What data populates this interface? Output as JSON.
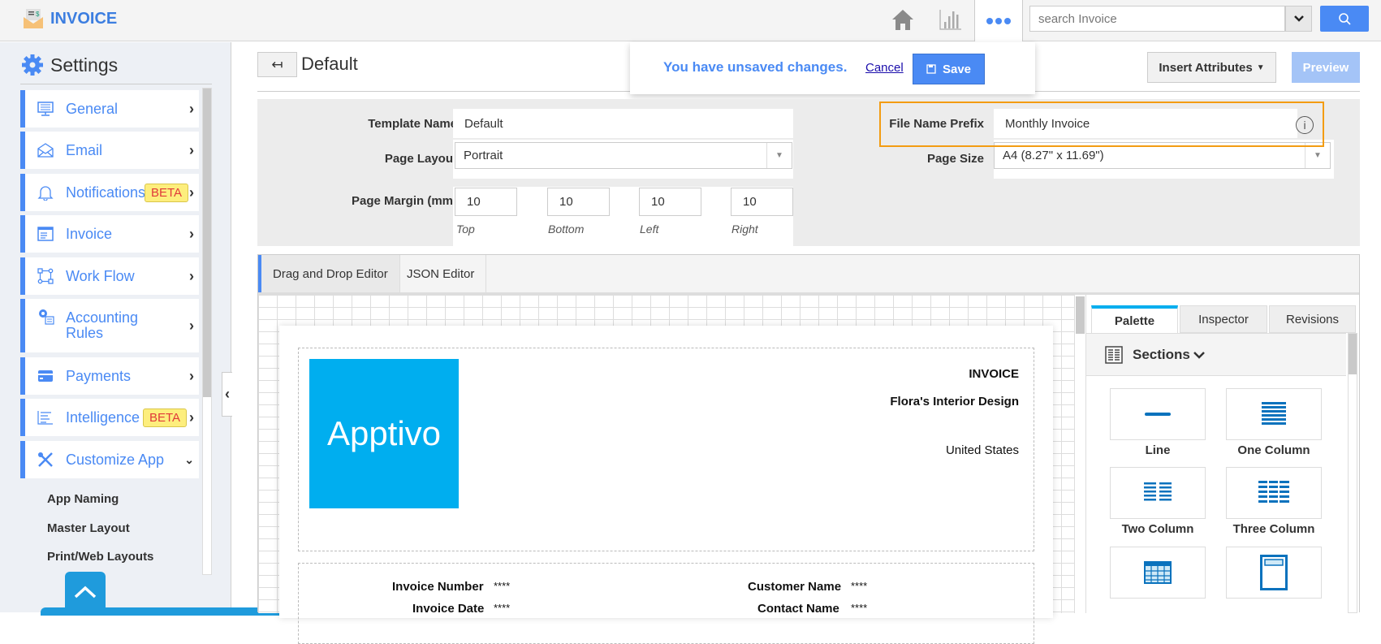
{
  "app": {
    "name": "INVOICE"
  },
  "topbar": {
    "search_placeholder": "search Invoice",
    "icons": [
      "home-icon",
      "chart-icon",
      "more-icon",
      "search-icon"
    ]
  },
  "sidebar": {
    "title": "Settings",
    "items": [
      {
        "label": "General",
        "icon": "monitor-icon"
      },
      {
        "label": "Email",
        "icon": "envelope-icon"
      },
      {
        "label": "Notifications",
        "icon": "bell-icon",
        "badge": "BETA"
      },
      {
        "label": "Invoice",
        "icon": "invoice-icon"
      },
      {
        "label": "Work Flow",
        "icon": "workflow-icon"
      },
      {
        "label": "Accounting Rules",
        "icon": "accounting-icon"
      },
      {
        "label": "Payments",
        "icon": "card-icon"
      },
      {
        "label": "Intelligence",
        "icon": "report-icon",
        "badge": "BETA"
      },
      {
        "label": "Customize App",
        "icon": "tools-icon",
        "expanded": true
      }
    ],
    "sub_items": [
      "App Naming",
      "Master Layout",
      "Print/Web Layouts"
    ]
  },
  "header": {
    "title": "Default",
    "unsaved_message": "You have unsaved changes.",
    "cancel_label": "Cancel",
    "save_label": "Save",
    "insert_attributes_label": "Insert Attributes",
    "preview_label": "Preview"
  },
  "form": {
    "template_name_label": "Template Name",
    "template_name_value": "Default",
    "page_layout_label": "Page Layout",
    "page_layout_value": "Portrait",
    "page_margin_label": "Page Margin (mm)",
    "margins": [
      {
        "label": "Top",
        "value": "10"
      },
      {
        "label": "Bottom",
        "value": "10"
      },
      {
        "label": "Left",
        "value": "10"
      },
      {
        "label": "Right",
        "value": "10"
      }
    ],
    "file_prefix_label": "File Name Prefix",
    "file_prefix_value": "Monthly Invoice",
    "page_size_label": "Page Size",
    "page_size_value": "A4 (8.27\" x 11.69\")"
  },
  "editor": {
    "tabs": [
      "Drag and Drop Editor",
      "JSON Editor"
    ],
    "active_tab": "Drag and Drop Editor",
    "document": {
      "logo_text": "Apptivo",
      "heading": "INVOICE",
      "company": "Flora's Interior Design",
      "country": "United States",
      "fields": [
        {
          "label": "Invoice Number",
          "value": "****"
        },
        {
          "label": "Customer Name",
          "value": "****"
        },
        {
          "label": "Invoice Date",
          "value": "****"
        },
        {
          "label": "Contact Name",
          "value": "****"
        }
      ]
    }
  },
  "palette": {
    "tabs": [
      "Palette",
      "Inspector",
      "Revisions"
    ],
    "active_tab": "Palette",
    "section_title": "Sections",
    "tiles": [
      "Line",
      "One Column",
      "Two Column",
      "Three Column",
      "Table",
      "Box"
    ]
  },
  "colors": {
    "accent": "#4a8af4",
    "highlight": "#f39c12",
    "logo_bg": "#00aeef",
    "beta_bg": "#fdee7d"
  }
}
